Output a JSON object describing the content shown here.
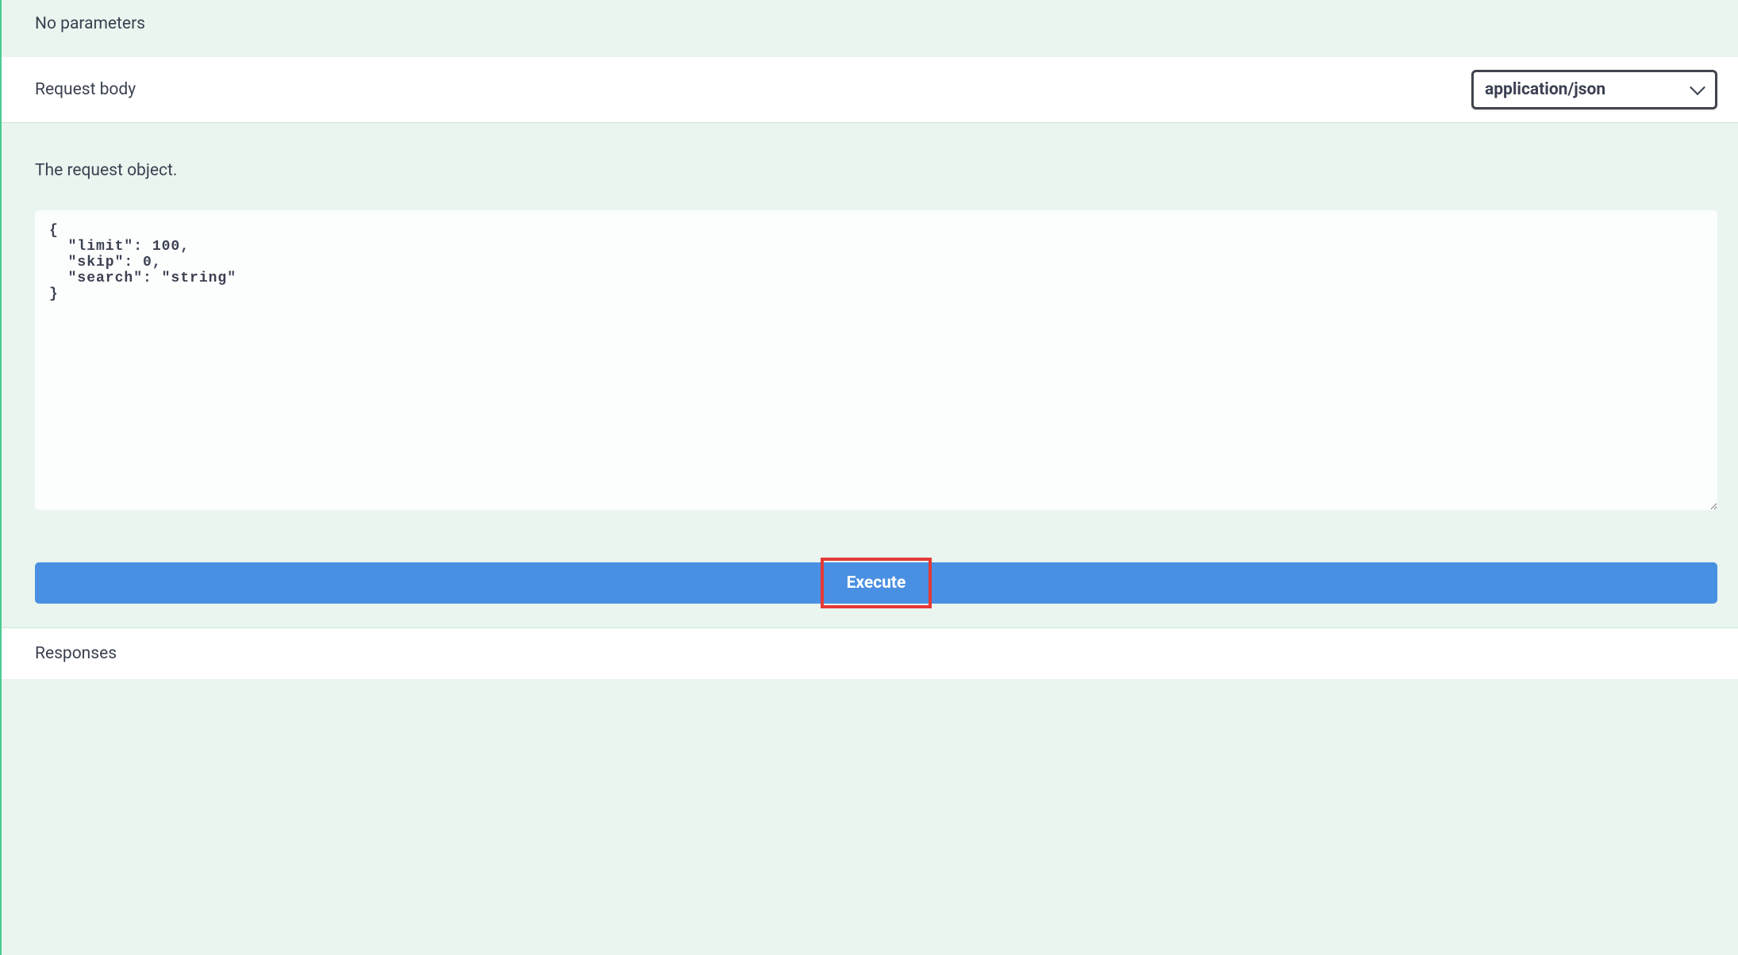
{
  "parameters": {
    "no_params_label": "No parameters"
  },
  "request_body": {
    "header_label": "Request body",
    "content_type_selected": "application/json",
    "description": "The request object.",
    "body_value": "{\n  \"limit\": 100,\n  \"skip\": 0,\n  \"search\": \"string\"\n}"
  },
  "actions": {
    "execute_label": "Execute"
  },
  "responses": {
    "header_label": "Responses"
  }
}
